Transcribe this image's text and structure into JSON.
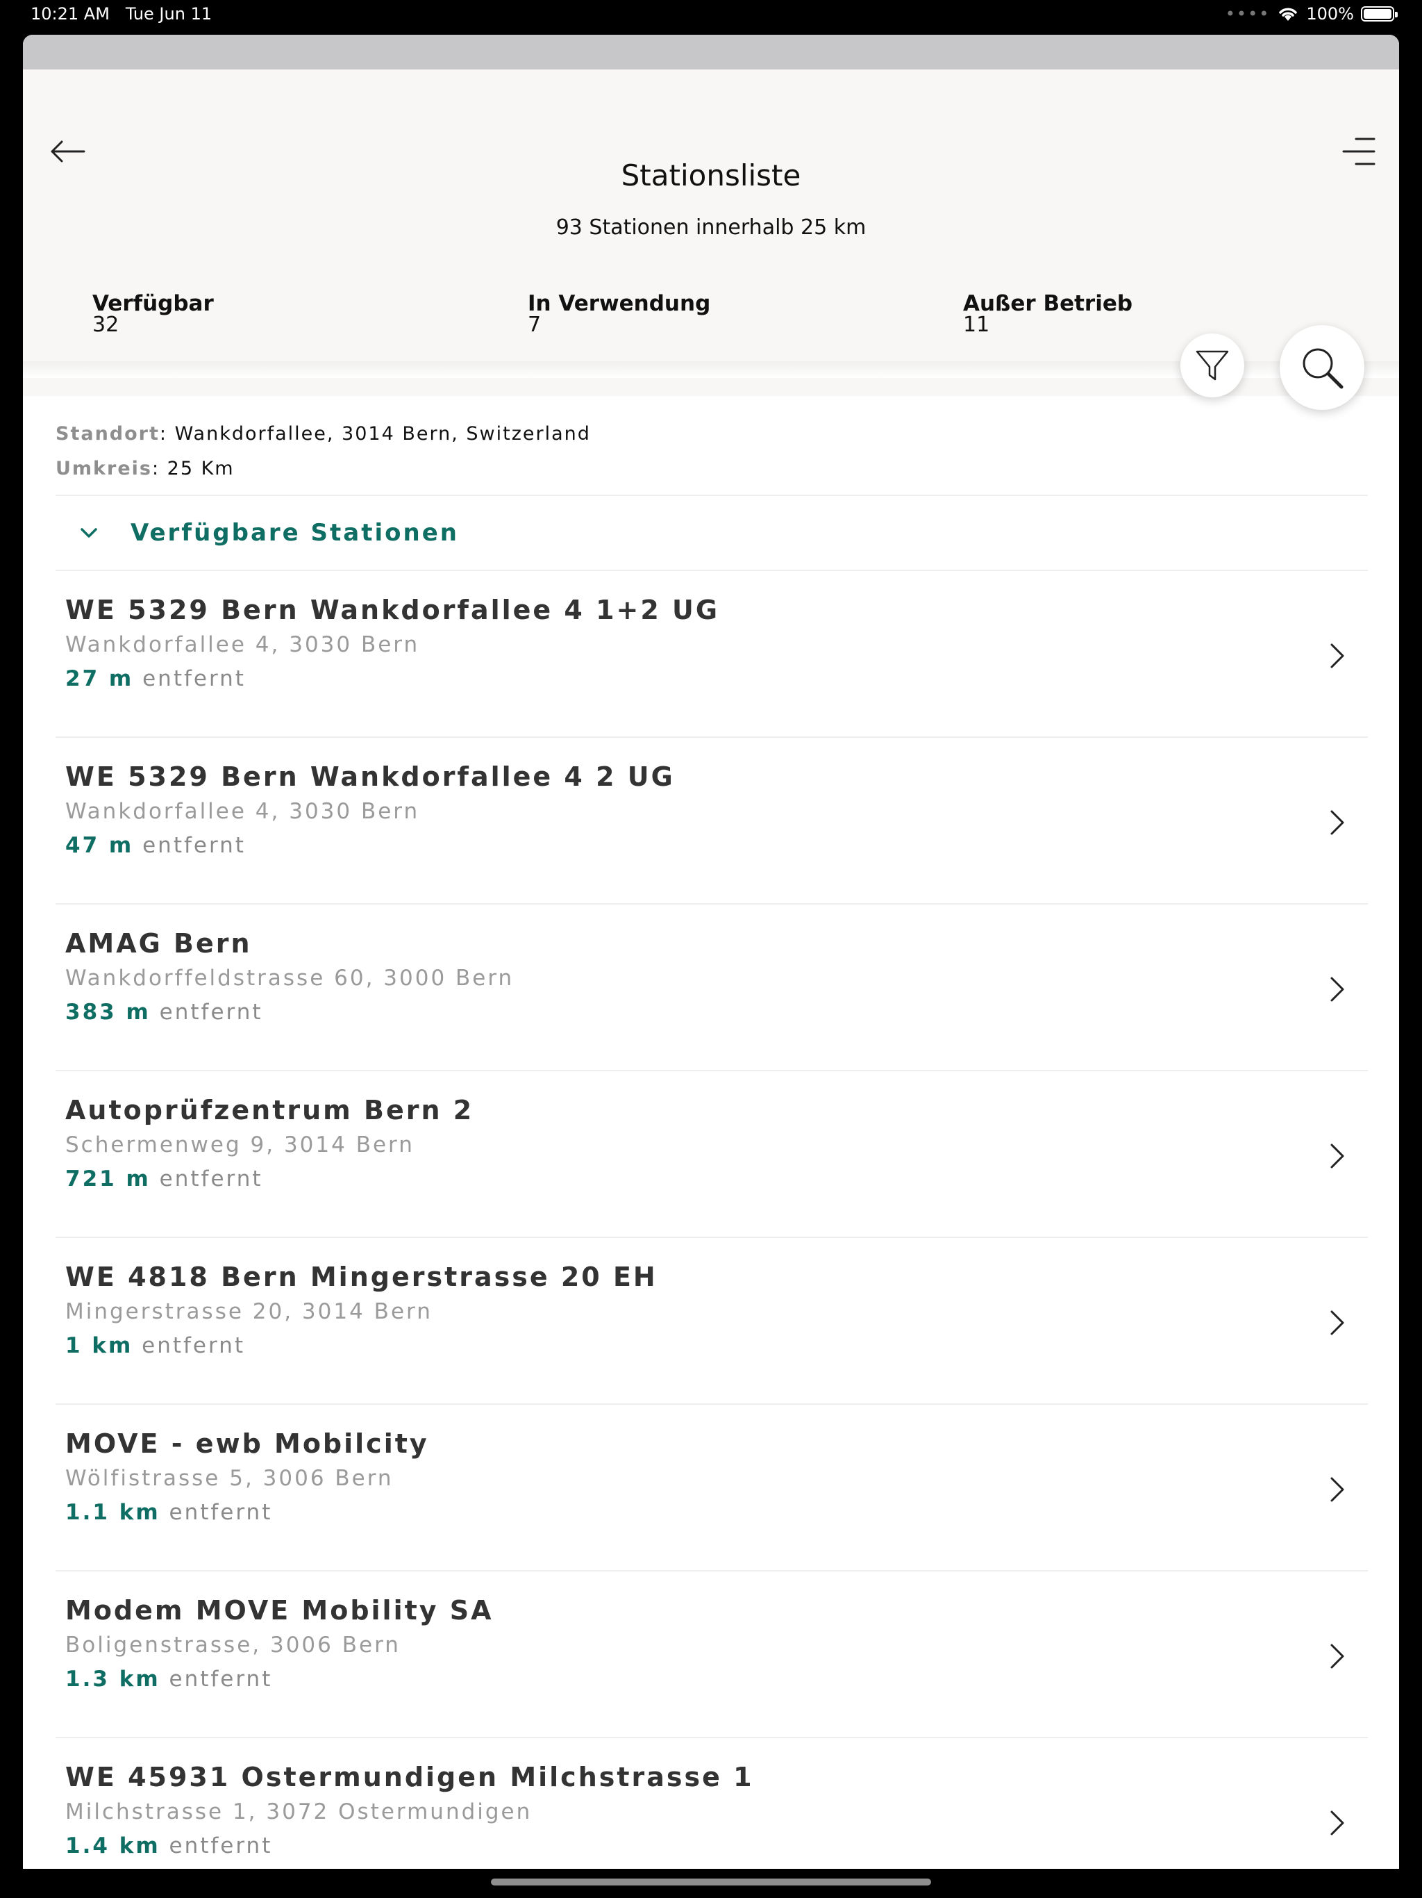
{
  "status_bar": {
    "time": "10:21 AM",
    "date": "Tue Jun 11",
    "battery": "100%"
  },
  "header": {
    "title": "Stationsliste",
    "subtitle": "93 Stationen innerhalb 25 km",
    "stats": [
      {
        "label": "Verfügbar",
        "value": "32"
      },
      {
        "label": "In Verwendung",
        "value": "7"
      },
      {
        "label": "Außer Betrieb",
        "value": "11"
      }
    ]
  },
  "location": {
    "standort_key": "Standort",
    "standort_value": ": Wankdorfallee, 3014 Bern, Switzerland",
    "umkreis_key": "Umkreis",
    "umkreis_value": ": 25 Km"
  },
  "section": {
    "label": "Verfügbare Stationen"
  },
  "stations": [
    {
      "name": "WE 5329 Bern Wankdorfallee 4 1+2 UG",
      "address": "Wankdorfallee 4, 3030 Bern",
      "distance": "27 m",
      "suffix": "entfernt"
    },
    {
      "name": "WE 5329 Bern Wankdorfallee 4 2 UG",
      "address": "Wankdorfallee 4, 3030 Bern",
      "distance": "47 m",
      "suffix": "entfernt"
    },
    {
      "name": "AMAG Bern",
      "address": "Wankdorffeldstrasse 60, 3000 Bern",
      "distance": "383 m",
      "suffix": "entfernt"
    },
    {
      "name": "Autoprüfzentrum Bern 2",
      "address": "Schermenweg 9, 3014 Bern",
      "distance": "721 m",
      "suffix": "entfernt"
    },
    {
      "name": "WE 4818 Bern Mingerstrasse 20 EH",
      "address": "Mingerstrasse 20, 3014 Bern",
      "distance": "1 km",
      "suffix": "entfernt"
    },
    {
      "name": "MOVE - ewb Mobilcity",
      "address": "Wölfistrasse 5, 3006 Bern",
      "distance": "1.1 km",
      "suffix": "entfernt"
    },
    {
      "name": "Modem MOVE Mobility SA",
      "address": "Boligenstrasse, 3006 Bern",
      "distance": "1.3 km",
      "suffix": "entfernt"
    },
    {
      "name": "WE 45931 Ostermundigen Milchstrasse 1",
      "address": "Milchstrasse 1, 3072 Ostermundigen",
      "distance": "1.4 km",
      "suffix": "entfernt"
    }
  ],
  "colors": {
    "accent": "#0f6e63",
    "header_bg": "#f8f7f5"
  },
  "icons": [
    "back-arrow-icon",
    "menu-icon",
    "filter-icon",
    "search-icon",
    "chevron-down-icon",
    "chevron-right-icon",
    "wifi-icon",
    "battery-icon"
  ]
}
